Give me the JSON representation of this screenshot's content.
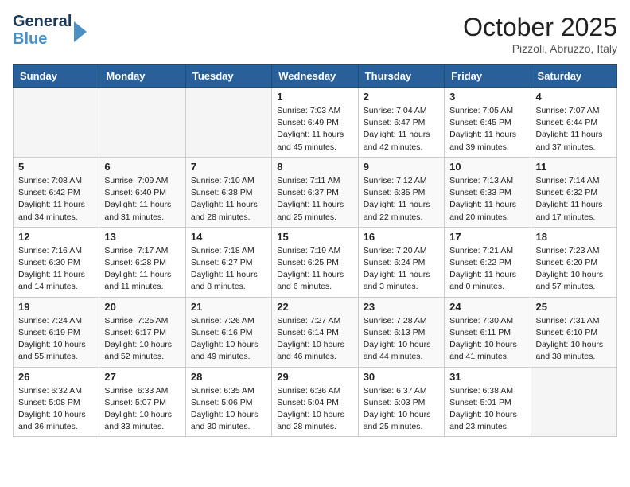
{
  "header": {
    "logo_line1": "General",
    "logo_line2": "Blue",
    "month": "October 2025",
    "location": "Pizzoli, Abruzzo, Italy"
  },
  "weekdays": [
    "Sunday",
    "Monday",
    "Tuesday",
    "Wednesday",
    "Thursday",
    "Friday",
    "Saturday"
  ],
  "weeks": [
    [
      {
        "day": "",
        "info": ""
      },
      {
        "day": "",
        "info": ""
      },
      {
        "day": "",
        "info": ""
      },
      {
        "day": "1",
        "info": "Sunrise: 7:03 AM\nSunset: 6:49 PM\nDaylight: 11 hours and 45 minutes."
      },
      {
        "day": "2",
        "info": "Sunrise: 7:04 AM\nSunset: 6:47 PM\nDaylight: 11 hours and 42 minutes."
      },
      {
        "day": "3",
        "info": "Sunrise: 7:05 AM\nSunset: 6:45 PM\nDaylight: 11 hours and 39 minutes."
      },
      {
        "day": "4",
        "info": "Sunrise: 7:07 AM\nSunset: 6:44 PM\nDaylight: 11 hours and 37 minutes."
      }
    ],
    [
      {
        "day": "5",
        "info": "Sunrise: 7:08 AM\nSunset: 6:42 PM\nDaylight: 11 hours and 34 minutes."
      },
      {
        "day": "6",
        "info": "Sunrise: 7:09 AM\nSunset: 6:40 PM\nDaylight: 11 hours and 31 minutes."
      },
      {
        "day": "7",
        "info": "Sunrise: 7:10 AM\nSunset: 6:38 PM\nDaylight: 11 hours and 28 minutes."
      },
      {
        "day": "8",
        "info": "Sunrise: 7:11 AM\nSunset: 6:37 PM\nDaylight: 11 hours and 25 minutes."
      },
      {
        "day": "9",
        "info": "Sunrise: 7:12 AM\nSunset: 6:35 PM\nDaylight: 11 hours and 22 minutes."
      },
      {
        "day": "10",
        "info": "Sunrise: 7:13 AM\nSunset: 6:33 PM\nDaylight: 11 hours and 20 minutes."
      },
      {
        "day": "11",
        "info": "Sunrise: 7:14 AM\nSunset: 6:32 PM\nDaylight: 11 hours and 17 minutes."
      }
    ],
    [
      {
        "day": "12",
        "info": "Sunrise: 7:16 AM\nSunset: 6:30 PM\nDaylight: 11 hours and 14 minutes."
      },
      {
        "day": "13",
        "info": "Sunrise: 7:17 AM\nSunset: 6:28 PM\nDaylight: 11 hours and 11 minutes."
      },
      {
        "day": "14",
        "info": "Sunrise: 7:18 AM\nSunset: 6:27 PM\nDaylight: 11 hours and 8 minutes."
      },
      {
        "day": "15",
        "info": "Sunrise: 7:19 AM\nSunset: 6:25 PM\nDaylight: 11 hours and 6 minutes."
      },
      {
        "day": "16",
        "info": "Sunrise: 7:20 AM\nSunset: 6:24 PM\nDaylight: 11 hours and 3 minutes."
      },
      {
        "day": "17",
        "info": "Sunrise: 7:21 AM\nSunset: 6:22 PM\nDaylight: 11 hours and 0 minutes."
      },
      {
        "day": "18",
        "info": "Sunrise: 7:23 AM\nSunset: 6:20 PM\nDaylight: 10 hours and 57 minutes."
      }
    ],
    [
      {
        "day": "19",
        "info": "Sunrise: 7:24 AM\nSunset: 6:19 PM\nDaylight: 10 hours and 55 minutes."
      },
      {
        "day": "20",
        "info": "Sunrise: 7:25 AM\nSunset: 6:17 PM\nDaylight: 10 hours and 52 minutes."
      },
      {
        "day": "21",
        "info": "Sunrise: 7:26 AM\nSunset: 6:16 PM\nDaylight: 10 hours and 49 minutes."
      },
      {
        "day": "22",
        "info": "Sunrise: 7:27 AM\nSunset: 6:14 PM\nDaylight: 10 hours and 46 minutes."
      },
      {
        "day": "23",
        "info": "Sunrise: 7:28 AM\nSunset: 6:13 PM\nDaylight: 10 hours and 44 minutes."
      },
      {
        "day": "24",
        "info": "Sunrise: 7:30 AM\nSunset: 6:11 PM\nDaylight: 10 hours and 41 minutes."
      },
      {
        "day": "25",
        "info": "Sunrise: 7:31 AM\nSunset: 6:10 PM\nDaylight: 10 hours and 38 minutes."
      }
    ],
    [
      {
        "day": "26",
        "info": "Sunrise: 6:32 AM\nSunset: 5:08 PM\nDaylight: 10 hours and 36 minutes."
      },
      {
        "day": "27",
        "info": "Sunrise: 6:33 AM\nSunset: 5:07 PM\nDaylight: 10 hours and 33 minutes."
      },
      {
        "day": "28",
        "info": "Sunrise: 6:35 AM\nSunset: 5:06 PM\nDaylight: 10 hours and 30 minutes."
      },
      {
        "day": "29",
        "info": "Sunrise: 6:36 AM\nSunset: 5:04 PM\nDaylight: 10 hours and 28 minutes."
      },
      {
        "day": "30",
        "info": "Sunrise: 6:37 AM\nSunset: 5:03 PM\nDaylight: 10 hours and 25 minutes."
      },
      {
        "day": "31",
        "info": "Sunrise: 6:38 AM\nSunset: 5:01 PM\nDaylight: 10 hours and 23 minutes."
      },
      {
        "day": "",
        "info": ""
      }
    ]
  ]
}
